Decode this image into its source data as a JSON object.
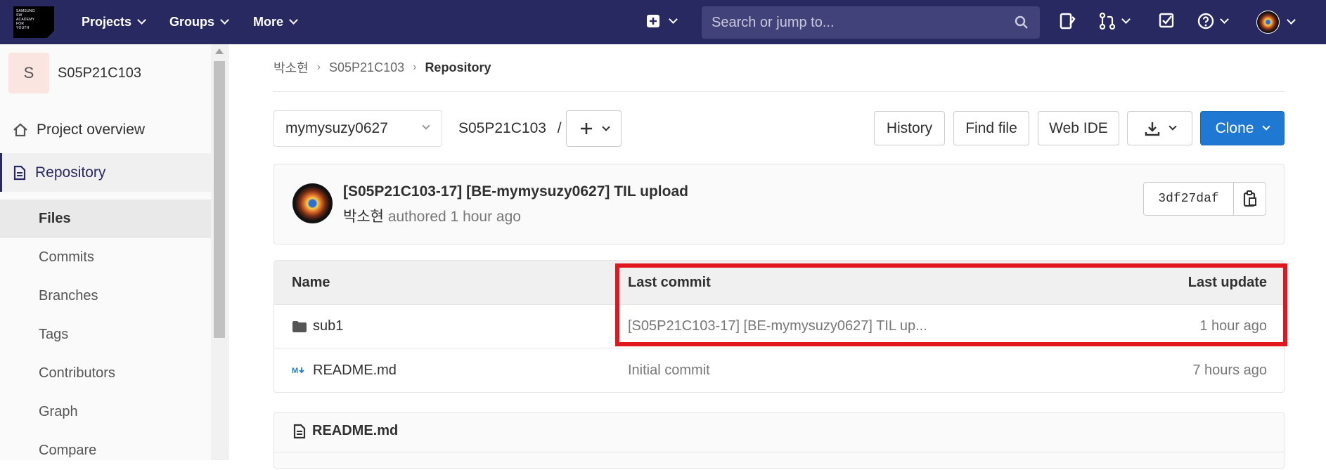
{
  "brand": {
    "logo_text": "SAMSUNG SW ACADEMY FOR YOUTH"
  },
  "topnav": {
    "items": [
      {
        "label": "Projects"
      },
      {
        "label": "Groups"
      },
      {
        "label": "More"
      }
    ],
    "search_placeholder": "Search or jump to..."
  },
  "sidebar": {
    "project_initial": "S",
    "project_name": "S05P21C103",
    "overview": "Project overview",
    "repository": "Repository",
    "sub_items": [
      "Files",
      "Commits",
      "Branches",
      "Tags",
      "Contributors",
      "Graph",
      "Compare"
    ]
  },
  "breadcrumb": {
    "owner": "박소현",
    "project": "S05P21C103",
    "current": "Repository"
  },
  "toolbar": {
    "branch": "mymysuzy0627",
    "path": "S05P21C103",
    "path_sep": "/",
    "history": "History",
    "find_file": "Find file",
    "web_ide": "Web IDE",
    "clone": "Clone"
  },
  "last_commit": {
    "title": "[S05P21C103-17] [BE-mymysuzy0627] TIL upload",
    "author": "박소현",
    "meta": "authored 1 hour ago",
    "sha": "3df27daf"
  },
  "table": {
    "headers": {
      "name": "Name",
      "last_commit": "Last commit",
      "last_update": "Last update"
    },
    "rows": [
      {
        "name": "sub1",
        "commit": "[S05P21C103-17] [BE-mymysuzy0627] TIL up...",
        "updated": "1 hour ago"
      },
      {
        "name": "README.md",
        "commit": "Initial commit",
        "updated": "7 hours ago"
      }
    ]
  },
  "readme": {
    "title": "README.md"
  },
  "colors": {
    "navbar": "#292961",
    "primary": "#1f78d1",
    "highlight": "#e0171f"
  }
}
